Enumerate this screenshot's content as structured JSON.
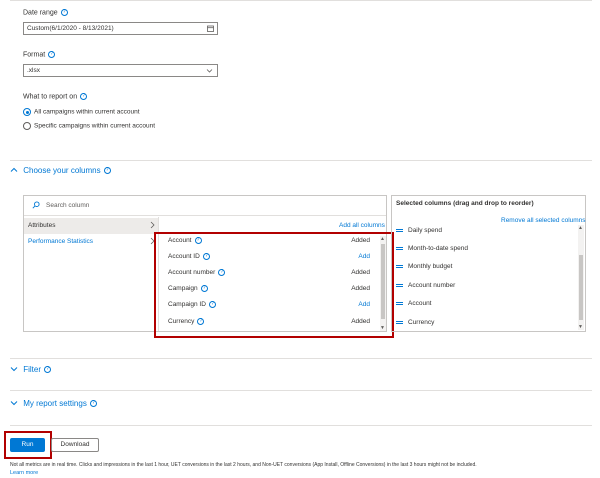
{
  "date_range": {
    "label": "Date range",
    "value": "Custom(6/1/2020 - 8/13/2021)"
  },
  "format": {
    "label": "Format",
    "value": ".xlsx"
  },
  "report_on": {
    "label": "What to report on",
    "options": [
      "All campaigns within current account",
      "Specific campaigns within current account"
    ],
    "selected_index": 0
  },
  "columns_section": {
    "title": "Choose your columns",
    "search_placeholder": "Search column",
    "categories": [
      "Attributes",
      "Performance Statistics"
    ],
    "add_all_label": "Add all columns",
    "rows": [
      {
        "name": "Account",
        "status": "Added"
      },
      {
        "name": "Account ID",
        "status": "Add"
      },
      {
        "name": "Account number",
        "status": "Added"
      },
      {
        "name": "Campaign",
        "status": "Added"
      },
      {
        "name": "Campaign ID",
        "status": "Add"
      },
      {
        "name": "Currency",
        "status": "Added"
      }
    ],
    "selected_title": "Selected columns (drag and drop to reorder)",
    "remove_all_label": "Remove all selected columns",
    "selected": [
      "Daily spend",
      "Month-to-date spend",
      "Monthly budget",
      "Account number",
      "Account",
      "Currency"
    ]
  },
  "filter_section": {
    "title": "Filter"
  },
  "settings_section": {
    "title": "My report settings"
  },
  "buttons": {
    "run": "Run",
    "download": "Download"
  },
  "footer": {
    "note": "Not all metrics are in real time. Clicks and impressions in the last 1 hour, UET conversions in the last 2 hours, and Non-UET conversions (App Install, Offline Conversions) in the last 3 hours might not be included.",
    "learn_more": "Learn more"
  },
  "colors": {
    "accent": "#0078d4",
    "highlight": "#b20000"
  },
  "icons": [
    "help-icon",
    "calendar-icon",
    "chevron-down-icon",
    "chevron-up-icon",
    "chevron-right-icon",
    "search-icon",
    "drag-handle-icon"
  ]
}
